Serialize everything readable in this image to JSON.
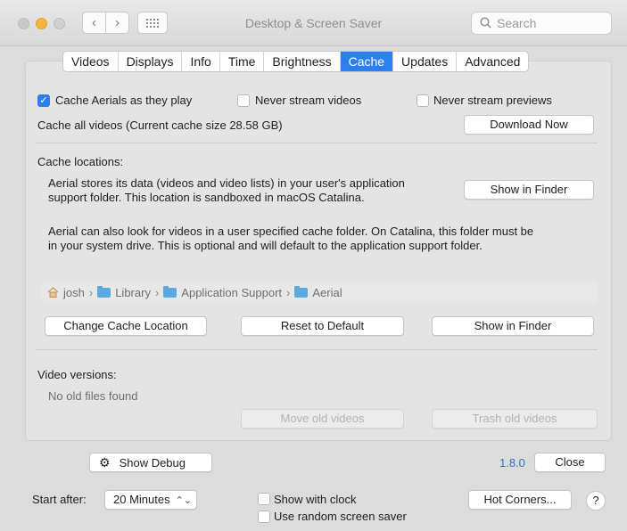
{
  "window": {
    "title": "Desktop & Screen Saver",
    "search_placeholder": "Search"
  },
  "tabs": [
    {
      "label": "Videos"
    },
    {
      "label": "Displays"
    },
    {
      "label": "Info"
    },
    {
      "label": "Time"
    },
    {
      "label": "Brightness"
    },
    {
      "label": "Cache",
      "active": true
    },
    {
      "label": "Updates"
    },
    {
      "label": "Advanced"
    }
  ],
  "cache": {
    "cache_aerials_label": "Cache Aerials as they play",
    "cache_aerials_checked": true,
    "never_stream_videos_label": "Never stream videos",
    "never_stream_previews_label": "Never stream previews",
    "cache_all_text": "Cache all videos (Current cache size 28.58 GB)",
    "download_now_label": "Download Now",
    "cache_locations_heading": "Cache locations:",
    "support_folder_text_1": "Aerial stores its data (videos and video lists) in your user's application",
    "support_folder_text_2": "support folder. This location is sandboxed in macOS Catalina.",
    "show_in_finder_label": "Show in Finder",
    "custom_folder_text_1": "Aerial can also look for videos in a user specified cache folder. On Catalina, this folder must be",
    "custom_folder_text_2": "in your system drive. This is optional and will default to the application support folder.",
    "path": [
      "josh",
      "Library",
      "Application Support",
      "Aerial"
    ],
    "change_location_label": "Change Cache Location",
    "reset_default_label": "Reset to Default",
    "show_in_finder_2_label": "Show in Finder",
    "video_versions_heading": "Video versions:",
    "no_old_files_text": "No old files found",
    "move_old_label": "Move old videos",
    "trash_old_label": "Trash old videos"
  },
  "footer": {
    "show_debug_label": "Show Debug",
    "version": "1.8.0",
    "close_label": "Close"
  },
  "bottom": {
    "start_after_label": "Start after:",
    "start_after_value": "20 Minutes",
    "show_with_clock_label": "Show with clock",
    "random_saver_label": "Use random screen saver",
    "hot_corners_label": "Hot Corners...",
    "help_label": "?"
  },
  "colors": {
    "accent": "#2a80f0",
    "version_link": "#2a70d0",
    "traffic_minimize": "#f5b53d"
  }
}
